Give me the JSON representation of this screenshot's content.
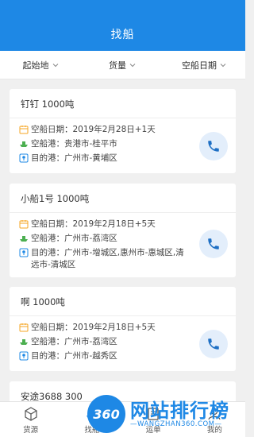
{
  "header": {
    "title": "找船"
  },
  "filters": [
    {
      "label": "起始地"
    },
    {
      "label": "货量"
    },
    {
      "label": "空船日期"
    }
  ],
  "cards": [
    {
      "title": "钉钉  1000吨",
      "empty_date": "空船日期：2019年2月28日+1天",
      "empty_port": "空船港：贵港市-桂平市",
      "dest_port": "目的港：广州市-黄埔区"
    },
    {
      "title": "小船1号  1000吨",
      "empty_date": "空船日期：2019年2月18日+5天",
      "empty_port": "空船港：广州市-荔湾区",
      "dest_port": "目的港：广州市-增城区,惠州市-惠城区,清远市-清城区"
    },
    {
      "title": "啊  1000吨",
      "empty_date": "空船日期：2019年2月18日+5天",
      "empty_port": "空船港：广州市-荔湾区",
      "dest_port": "目的港：广州市-越秀区"
    },
    {
      "title": "安途3688  300"
    }
  ],
  "tabbar": {
    "items": [
      {
        "label": "货源"
      },
      {
        "label": "找船"
      },
      {
        "label": "运单"
      },
      {
        "label": "我的"
      }
    ]
  },
  "watermark": {
    "badge": "360",
    "cn": "网站排行榜",
    "en": "—WANGZHAN360.COM—"
  },
  "colors": {
    "primary": "#1e88e5",
    "calendar": "#f5a623",
    "ship": "#4caf50",
    "pin": "#1e88e5"
  },
  "icons": {
    "calendar": "calendar-icon",
    "ship": "ship-icon",
    "pin": "location-pin-icon",
    "phone": "phone-icon"
  }
}
